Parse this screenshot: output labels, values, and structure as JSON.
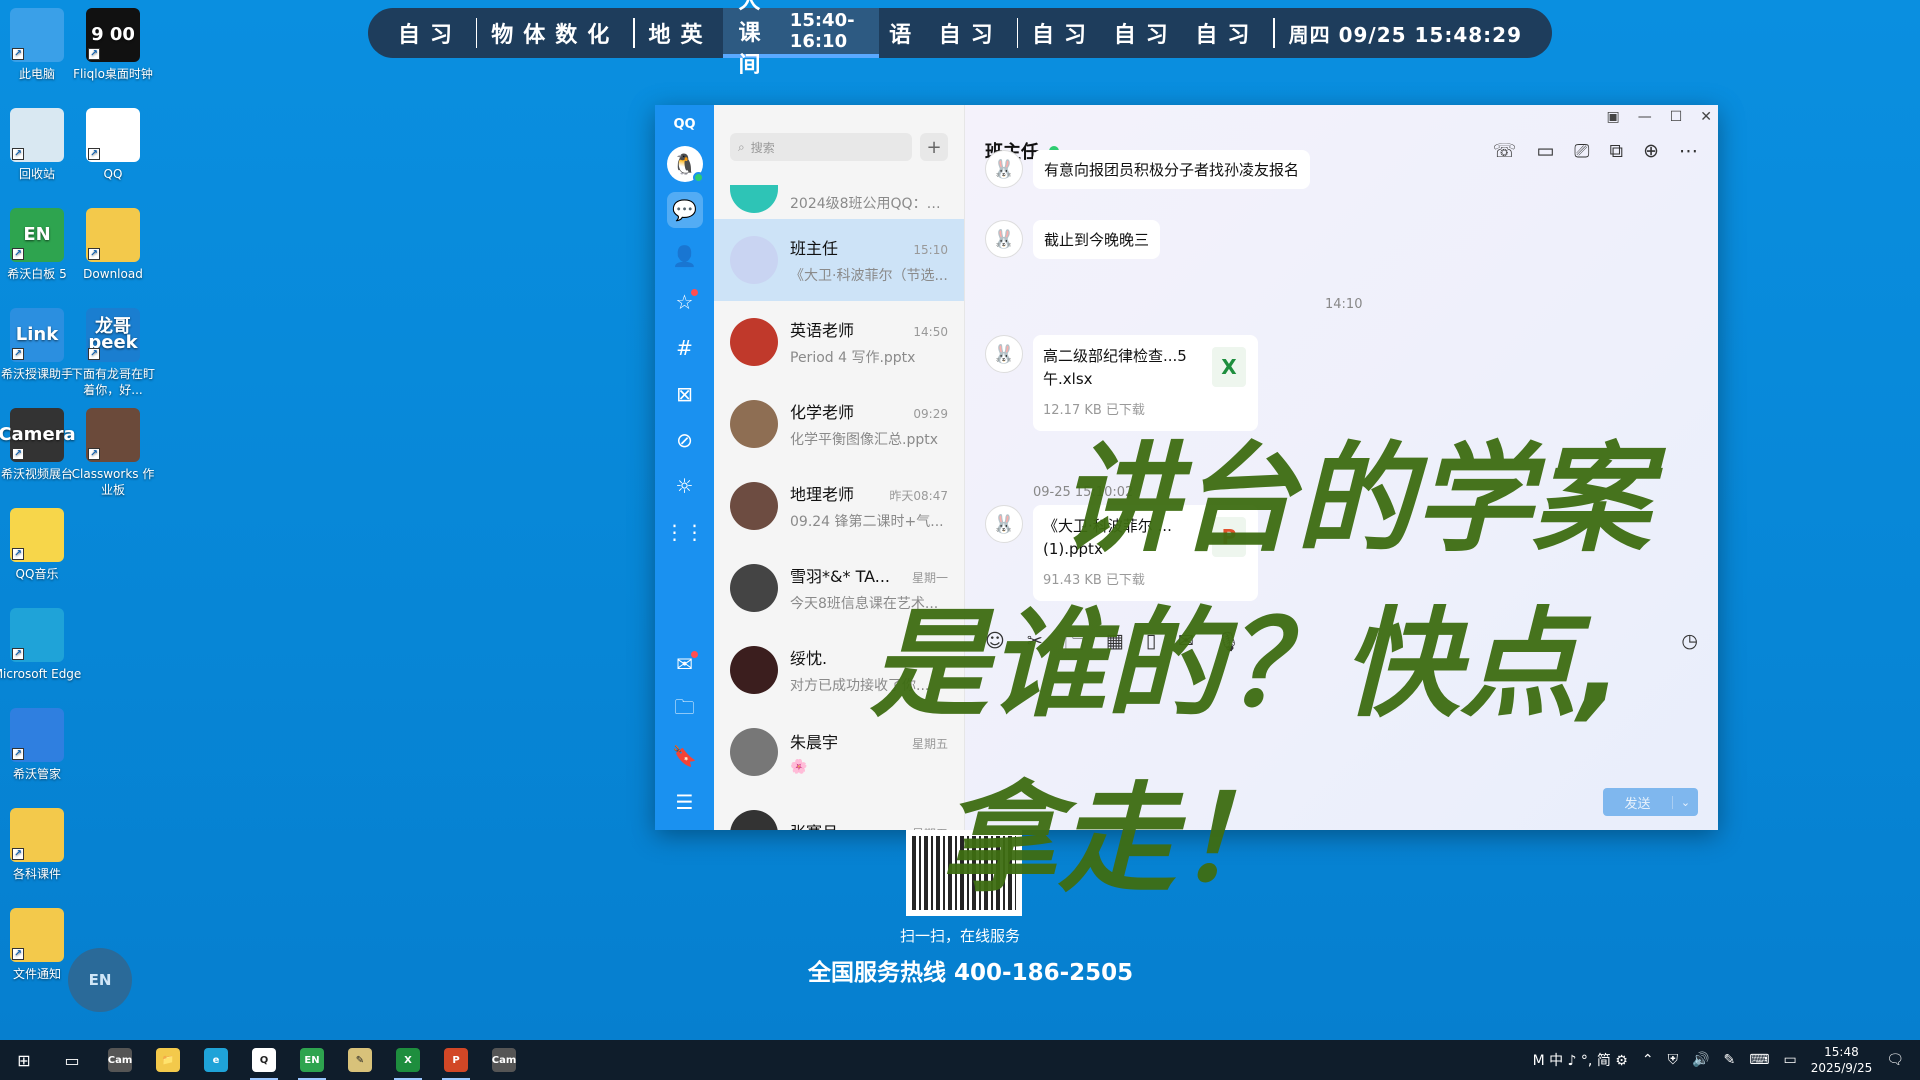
{
  "desktop_icons": [
    {
      "label": "此电脑",
      "icon": "computer-icon",
      "color": "#3aa0e8"
    },
    {
      "label": "Fliqlo桌面时钟",
      "icon": "clock-icon",
      "color": "#111111",
      "glyph": "9 00"
    },
    {
      "label": "回收站",
      "icon": "recycle-bin-icon",
      "color": "#d9e8f2"
    },
    {
      "label": "QQ",
      "icon": "qq-penguin-icon",
      "color": "#ffffff"
    },
    {
      "label": "希沃白板 5",
      "icon": "seewo-whiteboard-icon",
      "color": "#2ea44f",
      "glyph": "EN"
    },
    {
      "label": "Download",
      "icon": "folder-icon",
      "color": "#f3c94b"
    },
    {
      "label": "希沃授课助手",
      "icon": "link-icon",
      "color": "#2b8fe0",
      "glyph": "Link"
    },
    {
      "label": "下面有龙哥在盯着你，好...",
      "icon": "peek-icon",
      "color": "#1a7ed0",
      "glyph": "龙哥 peek"
    },
    {
      "label": "希沃视频展台",
      "icon": "camera-icon",
      "color": "#333333",
      "glyph": "Camera"
    },
    {
      "label": "Classworks 作业板",
      "icon": "portrait-icon",
      "color": "#6b4a3a"
    },
    {
      "label": "QQ音乐",
      "icon": "qq-music-icon",
      "color": "#f7d64a"
    },
    {
      "label": "Microsoft Edge",
      "icon": "edge-icon",
      "color": "#1fa3d8"
    },
    {
      "label": "希沃管家",
      "icon": "shield-icon",
      "color": "#2f7fe0"
    },
    {
      "label": "各科课件",
      "icon": "folder-icon",
      "color": "#f3c94b"
    },
    {
      "label": "文件通知",
      "icon": "warning-folder-icon",
      "color": "#f3c94b"
    }
  ],
  "schedule": {
    "segments": [
      "自习",
      "物体数化",
      "地英"
    ],
    "current": {
      "label": "大课间",
      "time": "15:40-16:10"
    },
    "after": [
      "语 自习",
      "自习 自习 自习"
    ],
    "clock": "周四 09/25  15:48:29"
  },
  "qq": {
    "logo": "QQ",
    "search_placeholder": "搜索",
    "chats": [
      {
        "name": "",
        "time": "",
        "preview": "2024级8班公用QQ：作...",
        "avatar_color": "#2ec4b6",
        "partial": true
      },
      {
        "name": "班主任",
        "time": "15:10",
        "preview": "《大卫·科波菲尔（节选...",
        "avatar_color": "#c9d4f2",
        "active": true
      },
      {
        "name": "英语老师",
        "time": "14:50",
        "preview": "Period 4 写作.pptx",
        "avatar_color": "#c0392b"
      },
      {
        "name": "化学老师",
        "time": "09:29",
        "preview": "化学平衡图像汇总.pptx",
        "avatar_color": "#8e6e53"
      },
      {
        "name": "地理老师",
        "time": "昨天08:47",
        "preview": "09.24 锋第二课时+气...",
        "avatar_color": "#6d4c41"
      },
      {
        "name": "雪羽*&* TA...",
        "time": "星期一",
        "preview": "今天8班信息课在艺术...",
        "avatar_color": "#444444"
      },
      {
        "name": "绥忱.",
        "time": "",
        "preview": "对方已成功接收了你...",
        "avatar_color": "#3b1e1e"
      },
      {
        "name": "朱晨宇",
        "time": "星期五",
        "preview": "🌸",
        "avatar_color": "#777777"
      },
      {
        "name": "张骞月",
        "time": "星期五",
        "preview": "",
        "avatar_color": "#333333"
      }
    ],
    "conversation": {
      "title": "班主任",
      "messages": [
        {
          "type": "text",
          "text": "有意向报团员积极分子者找孙凌友报名"
        },
        {
          "type": "text",
          "text": "截止到今晚晚三"
        },
        {
          "type": "time",
          "text": "14:10"
        },
        {
          "type": "file",
          "name": "高二级部纪律检查...5午.xlsx",
          "size": "12.17 KB  已下载",
          "kind": "X",
          "kind_color": "#1e8e3e"
        },
        {
          "type": "time",
          "text": "09-25 15:10:02"
        },
        {
          "type": "file",
          "name": "《大卫·科波菲尔 ... (1).pptx",
          "size": "91.43 KB  已下载",
          "kind": "P",
          "kind_color": "#e2522d"
        }
      ],
      "send_label": "发送"
    }
  },
  "qr_caption": "扫一扫，在线服务",
  "hotline": "全国服务热线 400-186-2505",
  "handwriting": {
    "line1": "讲台的学案",
    "line2": "是谁的？快点,",
    "line3": "拿走！",
    "color": "#3e6d12"
  },
  "floating_button": "EN",
  "taskbar": {
    "apps": [
      {
        "name": "camera-app",
        "glyph": "Cam",
        "color": "#555555",
        "running": false
      },
      {
        "name": "file-explorer",
        "glyph": "📁",
        "color": "#f3c94b",
        "running": false
      },
      {
        "name": "edge",
        "glyph": "e",
        "color": "#1fa3d8",
        "running": false
      },
      {
        "name": "qq",
        "glyph": "Q",
        "color": "#ffffff",
        "running": true
      },
      {
        "name": "seewo",
        "glyph": "EN",
        "color": "#2ea44f",
        "running": true
      },
      {
        "name": "notes",
        "glyph": "✎",
        "color": "#d8c27a",
        "running": false
      },
      {
        "name": "excel",
        "glyph": "X",
        "color": "#1e8e3e",
        "running": true
      },
      {
        "name": "powerpoint",
        "glyph": "P",
        "color": "#d24726",
        "running": true
      },
      {
        "name": "camera-app-2",
        "glyph": "Cam",
        "color": "#555555",
        "running": false
      }
    ],
    "ime": "M 中 ♪ °, 简 ⚙",
    "time": "15:48",
    "date": "2025/9/25"
  }
}
